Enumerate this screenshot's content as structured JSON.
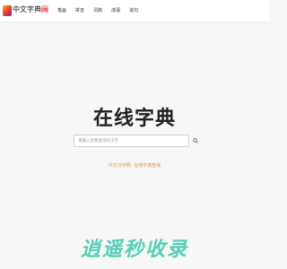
{
  "header": {
    "logo_text_a": "中文",
    "logo_text_b": "字典",
    "logo_text_c": "网",
    "nav": [
      {
        "label": "字典"
      },
      {
        "label": "笔画"
      },
      {
        "label": "拼音"
      },
      {
        "label": "词典"
      },
      {
        "label": "成语"
      },
      {
        "label": "造句"
      }
    ],
    "active_nav": "字典"
  },
  "main": {
    "title": "在线字典",
    "search": {
      "placeholder": "请输入您要查询的汉字",
      "value": ""
    },
    "links": [
      "中文汉字网",
      "在线字典查询"
    ]
  },
  "watermark": "逍遥秒收录",
  "colors": {
    "accent": "#e53935",
    "link": "#d99a3a",
    "watermark": "#1ec3a0"
  }
}
